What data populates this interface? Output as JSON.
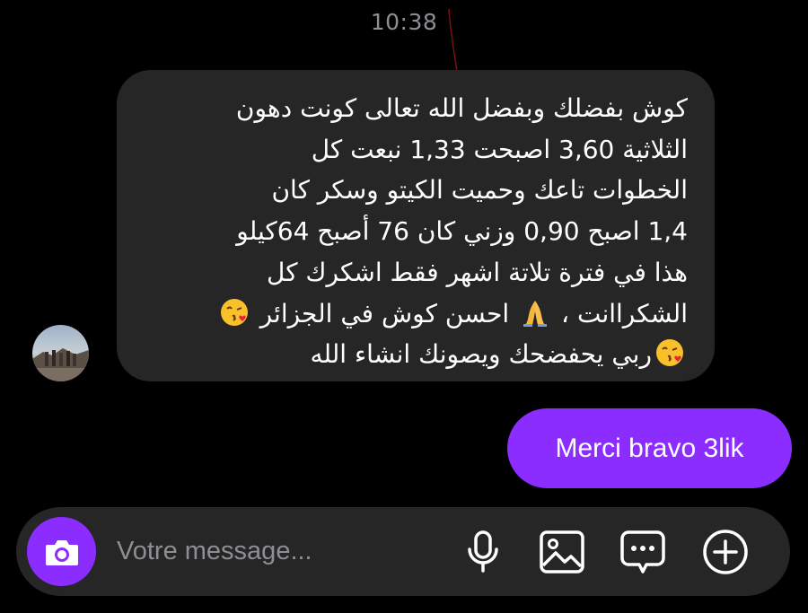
{
  "timestamp": "10:38",
  "incoming_message": {
    "lines": [
      "كوش بفضلك وبفضل الله تعالى كونت دهون",
      "الثلاثية 3,60 اصبحت 1,33  نبعت كل",
      "الخطوات تاعك وحميت الكيتو وسكر كان",
      "1,4 اصبح 0,90 وزني كان 76 أصبح 64كيلو",
      "هذا في فترة تلاتة اشهر فقط اشكرك كل",
      "الشكراانت ، ",
      " احسن كوش في الجزائر ",
      "ربي يحفضحك ويصونك انشاء الله"
    ]
  },
  "outgoing_message": {
    "text": "Merci bravo 3lik"
  },
  "composer": {
    "placeholder": "Votre message..."
  },
  "icons": {
    "camera": "camera-icon",
    "mic": "microphone-icon",
    "gallery": "image-icon",
    "sticker": "chat-bubble-dots-icon",
    "plus": "plus-circle-icon",
    "emoji_kiss": "face-blowing-kiss-emoji",
    "emoji_pray": "folded-hands-emoji"
  },
  "colors": {
    "background": "#000000",
    "incoming_bubble": "#262626",
    "outgoing_bubble": "#8b2dff",
    "accent": "#8b2dff",
    "muted_text": "#8e8e93",
    "text": "#ffffff"
  }
}
